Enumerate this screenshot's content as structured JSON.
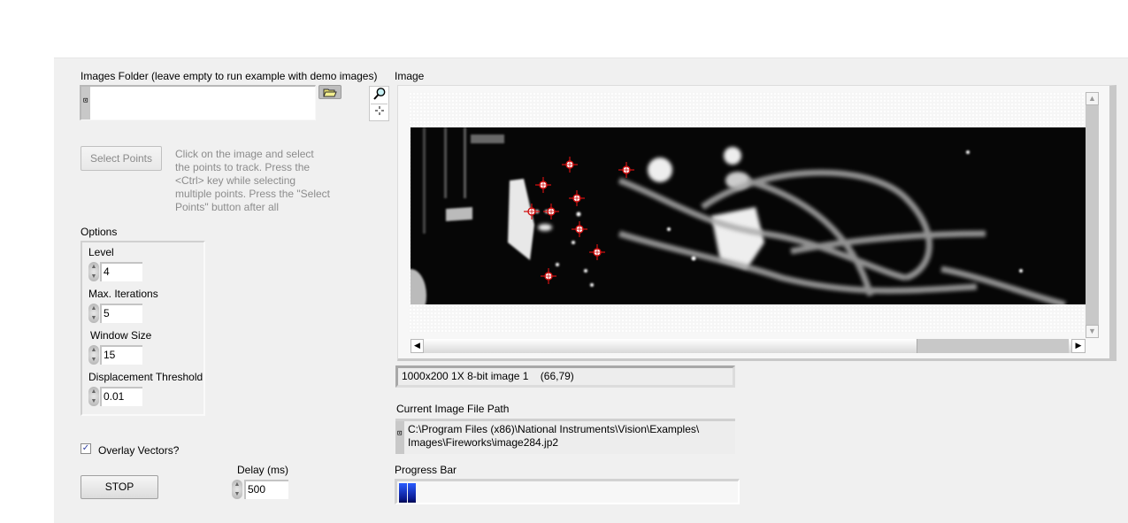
{
  "images_folder": {
    "label": "Images Folder (leave empty to run example with demo images)",
    "value": "",
    "browse_icon": "folder-open-icon"
  },
  "select_points": {
    "label": "Select Points",
    "enabled": false,
    "hint": "Click on the image and select the points to track. Press the <Ctrl> key while selecting multiple points. Press the \"Select Points\" button after  all"
  },
  "options": {
    "title": "Options",
    "fields": [
      {
        "label": "Level",
        "value": "4"
      },
      {
        "label": "Max. Iterations",
        "value": "5"
      },
      {
        "label": "Window Size",
        "value": "15"
      },
      {
        "label": "Displacement Threshold",
        "value": "0.01"
      }
    ]
  },
  "overlay_vectors": {
    "label": "Overlay Vectors?",
    "checked": true,
    "check_glyph": "✓"
  },
  "stop_button": {
    "label": "STOP"
  },
  "delay": {
    "label": "Delay (ms)",
    "value": "500"
  },
  "image_display": {
    "label": "Image",
    "tools": [
      "zoom-icon",
      "crosshair-icon"
    ],
    "info": "1000x200 1X 8-bit image 1    (66,79)",
    "tracked_points_count": 10,
    "vertical_scroll_fraction": 0.0,
    "horizontal_scroll_fraction": 1.0
  },
  "current_path": {
    "label": "Current Image File Path",
    "line1": "C:\\Program Files (x86)\\National Instruments\\Vision\\Examples\\",
    "line2": "Images\\Fireworks\\image284.jp2"
  },
  "progress": {
    "label": "Progress Bar",
    "value_percent": 5
  },
  "colors": {
    "marker": "#d01010",
    "progress_fill": "#1a3ad0",
    "panel_bg": "#f0f0f0"
  }
}
